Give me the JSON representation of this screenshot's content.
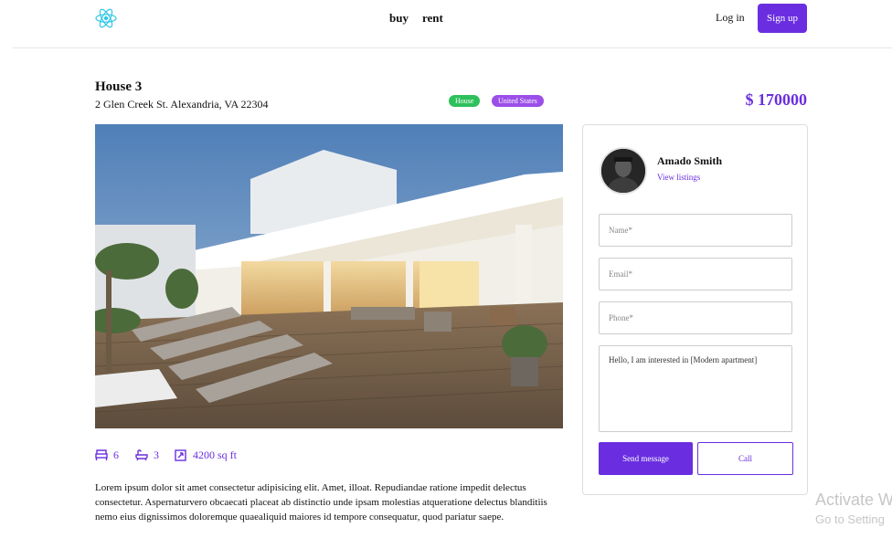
{
  "header": {
    "logo_icon": "react-atom-icon",
    "nav": {
      "buy": "buy",
      "rent": "rent"
    },
    "login": "Log in",
    "signup": "Sign up"
  },
  "listing": {
    "title": "House 3",
    "address": "2 Glen Creek St. Alexandria, VA 22304",
    "badges": {
      "type": "House",
      "country": "United States"
    },
    "price": "$ 170000",
    "features": {
      "beds": "6",
      "baths": "3",
      "area": "4200 sq ft"
    },
    "description": "Lorem ipsum dolor sit amet consectetur adipisicing elit. Amet, illoat. Repudiandae ratione impedit delectus consectetur. Aspernaturvero obcaecati placeat ab distinctio unde ipsam molestias atqueratione delectus blanditiis nemo eius dignissimos doloremque quaealiquid maiores id tempore consequatur, quod pariatur saepe."
  },
  "agent": {
    "name": "Amado Smith",
    "view_listings": "View listings"
  },
  "form": {
    "name_placeholder": "Name*",
    "email_placeholder": "Email*",
    "phone_placeholder": "Phone*",
    "message_value": "Hello, I am interested in [Modern apartment]",
    "send": "Send message",
    "call": "Call"
  },
  "watermark": {
    "line1": "Activate W",
    "line2": "Go to Setting"
  },
  "colors": {
    "accent": "#6a2ee0",
    "badge_green": "#2ec05b",
    "badge_purple": "#9b4ee8"
  }
}
